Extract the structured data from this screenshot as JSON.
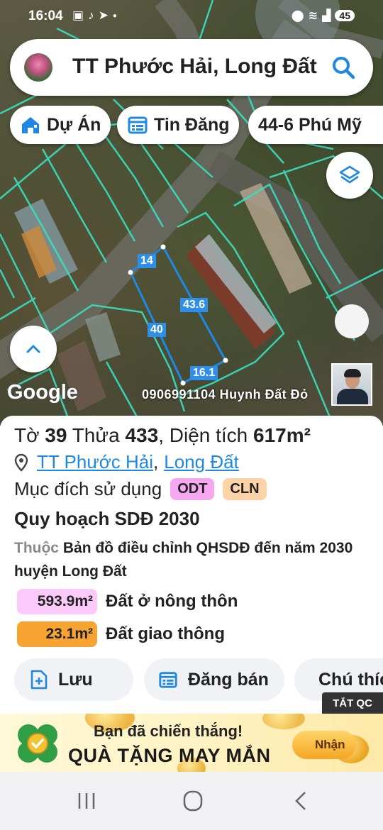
{
  "status_bar": {
    "time": "16:04",
    "left_icons": [
      "screenshot-icon",
      "tiktok-icon",
      "telegram-icon",
      "dot-icon"
    ],
    "right_icons": [
      "location-icon",
      "wifi-icon",
      "signal-icon"
    ],
    "battery": "45"
  },
  "search": {
    "text": "TT Phước Hải, Long Đất",
    "icon": "search-icon"
  },
  "chips": [
    {
      "label": "Dự Án",
      "icon": "home-icon"
    },
    {
      "label": "Tin Đăng",
      "icon": "calendar-list-icon"
    },
    {
      "label": "44-6 Phú Mỹ",
      "icon": ""
    }
  ],
  "map": {
    "google_logo": "Google",
    "dimensions": [
      "14",
      "43.6",
      "40",
      "16.1"
    ],
    "agent_text": "0906991104 Huynh Đất Đỏ",
    "boundary_color": "#1e88e5",
    "parcel_grid_color": "#38e0c0"
  },
  "parcel": {
    "sheet_label": "Tờ",
    "sheet": "39",
    "plot_label": "Thửa",
    "plot": "433",
    "area_label": "Diện tích",
    "area": "617m²",
    "location_parts": [
      "TT Phước Hải",
      "Long Đất"
    ],
    "location_separator": ",",
    "purpose_label": "Mục đích sử dụng",
    "purpose_badges": [
      {
        "code": "ODT",
        "color": "#f5a8f0"
      },
      {
        "code": "CLN",
        "color": "#fcd3a6"
      }
    ],
    "plan_title": "Quy hoạch SDĐ 2030",
    "plan_prefix": "Thuộc",
    "plan_source": "Bản đồ điều chỉnh QHSDĐ đến năm 2030 huyện Long Đất",
    "areas": [
      {
        "value": "593.9m²",
        "label": "Đất ở nông thôn",
        "color": "#fbc9fa"
      },
      {
        "value": "23.1m²",
        "label": "Đất giao thông",
        "color": "#f7a432"
      }
    ]
  },
  "actions": [
    {
      "label": "Lưu",
      "icon": "save-plus-icon"
    },
    {
      "label": "Đăng bán",
      "icon": "calendar-list-icon"
    },
    {
      "label": "Chú thích",
      "icon": "contrast-icon"
    }
  ],
  "ad": {
    "close_label": "TẮT QC",
    "small_text": "Bạn đã chiến thắng!",
    "big_text": "QUÀ TẶNG MAY MẮN",
    "button_label": "Nhận"
  },
  "nav": [
    "recent-apps-icon",
    "home-circle-icon",
    "back-icon"
  ]
}
